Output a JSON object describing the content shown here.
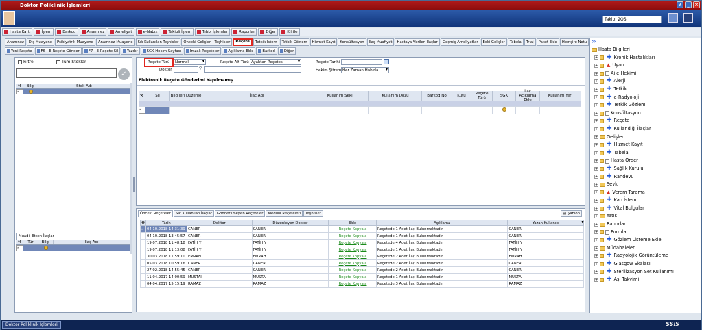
{
  "app": {
    "title": "Doktor Poliklinik İşlemleri",
    "takip": "Takip: 2OS",
    "logo": "SSiS"
  },
  "menu": [
    {
      "label": "Hasta Kartı",
      "icon": "card-icon"
    },
    {
      "label": "İşlem",
      "icon": "process-icon"
    },
    {
      "label": "Barkod",
      "icon": "barcode-icon"
    },
    {
      "label": "Anamnez",
      "icon": "anamnez-icon"
    },
    {
      "label": "Ameliyat",
      "icon": "surgery-icon"
    },
    {
      "label": "e-Nabız",
      "icon": "pulse-icon"
    },
    {
      "label": "Takipli İşlem",
      "icon": "track-icon"
    },
    {
      "label": "Tıbbi İşlemler",
      "icon": "medical-icon"
    },
    {
      "label": "Raporlar",
      "icon": "report-icon"
    },
    {
      "label": "Diğer",
      "icon": "other-icon"
    },
    {
      "label": "Kilitle",
      "icon": "lock-icon"
    }
  ],
  "tabs": [
    "Anamnez",
    "Dış Muayene",
    "Psikiyatrik Muayene",
    "Anamnez Muayene",
    "Sık Kullanılan Teşhisler",
    "Önceki Gelişler - Teşhisler",
    "Reçete",
    "Tetkik İstem",
    "Tetkik Gözlem",
    "Hizmet Kayıt",
    "Konsültasyon",
    "İlaç Muafiyet",
    "Hastaya Verilen İlaçlar",
    "Geçmiş Ameliyatlar",
    "Eski Gelişler",
    "Tabela",
    "Triaj",
    "Paket Ekle",
    "Hemşire Notu"
  ],
  "toolbar": [
    "Yeni Reçete",
    "F6 - E-Reçete Gönder",
    "F7 - E-Reçete Sil",
    "Yazdır",
    "SGK Hekim Sayfası",
    "İmzalı Reçeteler",
    "Açıklama Ekle",
    "Barkod",
    "Diğer"
  ],
  "left": {
    "filtre": "Filtre",
    "tum_stoklar": "Tüm Stoklar",
    "col_bilgi": "Bilgi",
    "col_stok_adi": "Stok Adı",
    "muadil_tab": "Muadil Etken İlaçlar",
    "col_tur": "Tür",
    "col_bilgi2": "Bilgi",
    "col_ilac_adi": "İlaç Adı"
  },
  "form": {
    "recete_turu_label": "Reçete Türü",
    "recete_turu": "Normal",
    "doktor_label": "Doktor",
    "alt_turu_label": "Reçete Alt Türü",
    "alt_turu": "Ayaktan Reçetesi",
    "tarih_label": "Reçete Tarihi",
    "sitem_label": "Hekim Şitremi",
    "sitem": "Her Zaman Habirla",
    "status": "Elektronik Reçete Gönderimi Yapılmamış"
  },
  "rx_cols": [
    "Sil",
    "Bilgileri Düzenle",
    "İlaç Adı",
    "Kullanım Şekli",
    "Kullanım Dozu",
    "Barkod No",
    "Kutu",
    "Reçete Türü",
    "SGK",
    "İlaç Açıklama Ekle",
    "Kullanım Yeri"
  ],
  "bottom_tabs": [
    "Önceki Reçeteler",
    "Sık Kullanılan İlaçlar",
    "Gönderilmeyen Reçeteler",
    "Medula Reçeteleri",
    "Teşhisler"
  ],
  "sablon": "Şablon",
  "history": {
    "cols": [
      "Tarih",
      "Doktor",
      "Düzenleyen Doktor",
      "Ekle",
      "Açıklama",
      "Yazan Kullanıcı"
    ],
    "rows": [
      {
        "tarih": "04.10.2018 14:31:39",
        "doktor": "CANER",
        "duzenleyen": "CANER",
        "ekle": "Reçete Kopyala",
        "aciklama": "Reçetede 1 Adet İlaç Bulunmaktadır.",
        "yazan": "CANER"
      },
      {
        "tarih": "04.10.2018 13:45:57",
        "doktor": "CANER",
        "duzenleyen": "CANER",
        "ekle": "Reçete Kopyala",
        "aciklama": "Reçetede 1 Adet İlaç Bulunmaktadır.",
        "yazan": "CANER"
      },
      {
        "tarih": "19.07.2018 11:48:18",
        "doktor": "FATİH Y",
        "duzenleyen": "FATİH Y",
        "ekle": "Reçete Kopyala",
        "aciklama": "Reçetede 4 Adet İlaç Bulunmaktadır.",
        "yazan": "FATİH Y"
      },
      {
        "tarih": "19.07.2018 11:13:08",
        "doktor": "FATİH Y",
        "duzenleyen": "FATİH Y",
        "ekle": "Reçete Kopyala",
        "aciklama": "Reçetede 1 Adet İlaç Bulunmaktadır.",
        "yazan": "FATİH Y"
      },
      {
        "tarih": "30.03.2018 11:59:10",
        "doktor": "EMRAH",
        "duzenleyen": "EMRAH",
        "ekle": "Reçete Kopyala",
        "aciklama": "Reçetede 2 Adet İlaç Bulunmaktadır.",
        "yazan": "EMRAH"
      },
      {
        "tarih": "05.03.2018 10:59:16",
        "doktor": "CANER",
        "duzenleyen": "CANER",
        "ekle": "Reçete Kopyala",
        "aciklama": "Reçetede 2 Adet İlaç Bulunmaktadır.",
        "yazan": "CANER"
      },
      {
        "tarih": "27.02.2018 14:55:45",
        "doktor": "CANER",
        "duzenleyen": "CANER",
        "ekle": "Reçete Kopyala",
        "aciklama": "Reçetede 2 Adet İlaç Bulunmaktadır.",
        "yazan": "CANER"
      },
      {
        "tarih": "11.04.2017 14:00:59",
        "doktor": "MUSTAI",
        "duzenleyen": "MUSTAI",
        "ekle": "Reçete Kopyala",
        "aciklama": "Reçetede 1 Adet İlaç Bulunmaktadır.",
        "yazan": "MUSTAI"
      },
      {
        "tarih": "04.04.2017 15:15:19",
        "doktor": "RAMAZ",
        "duzenleyen": "RAMAZ",
        "ekle": "Reçete Kopyala",
        "aciklama": "Reçetede 3 Adet İlaç Bulunmaktadır.",
        "yazan": "RAMAZ"
      }
    ]
  },
  "tree_title": "Hasta Bilgileri",
  "tree": [
    {
      "label": "Kronik Hastalıkları",
      "lvl": 1,
      "type": "plus"
    },
    {
      "label": "Uyarı",
      "lvl": 1,
      "type": "warn"
    },
    {
      "label": "Aile Hekimi",
      "lvl": 1,
      "type": "doc"
    },
    {
      "label": "Alerji",
      "lvl": 1,
      "type": "plus"
    },
    {
      "label": "Tetkik",
      "lvl": 1,
      "type": "plus"
    },
    {
      "label": "e-Radyoloji",
      "lvl": 1,
      "type": "plus"
    },
    {
      "label": "Tetkik Gözlem",
      "lvl": 1,
      "type": "plus"
    },
    {
      "label": "Konsültasyon",
      "lvl": 1,
      "type": "doc"
    },
    {
      "label": "Reçete",
      "lvl": 1,
      "type": "plus"
    },
    {
      "label": "Kullandığı İlaçlar",
      "lvl": 1,
      "type": "plus"
    },
    {
      "label": "Gelişler",
      "lvl": 0,
      "type": "folder"
    },
    {
      "label": "Hizmet Kayıt",
      "lvl": 1,
      "type": "plus"
    },
    {
      "label": "Tabela",
      "lvl": 1,
      "type": "plus"
    },
    {
      "label": "Hasta Order",
      "lvl": 1,
      "type": "doc"
    },
    {
      "label": "Sağlık Kurulu",
      "lvl": 1,
      "type": "plus"
    },
    {
      "label": "Randevu",
      "lvl": 1,
      "type": "plus"
    },
    {
      "label": "Sevk",
      "lvl": 0,
      "type": "folder"
    },
    {
      "label": "Verem Tarama",
      "lvl": 1,
      "type": "warn"
    },
    {
      "label": "Kan İstemi",
      "lvl": 1,
      "type": "plus"
    },
    {
      "label": "Vital Bulgular",
      "lvl": 1,
      "type": "plus"
    },
    {
      "label": "Yatış",
      "lvl": 0,
      "type": "folder"
    },
    {
      "label": "Raporlar",
      "lvl": 0,
      "type": "folder"
    },
    {
      "label": "Formlar",
      "lvl": 1,
      "type": "doc"
    },
    {
      "label": "Gözlem Listeme Ekle",
      "lvl": 1,
      "type": "plus"
    },
    {
      "label": "Müdahaleler",
      "lvl": 0,
      "type": "folder"
    },
    {
      "label": "Radyolojik Görüntüleme",
      "lvl": 1,
      "type": "plus"
    },
    {
      "label": "Glasgow Skalası",
      "lvl": 1,
      "type": "plus"
    },
    {
      "label": "Sterilizasyon Set Kullanımı",
      "lvl": 1,
      "type": "plus"
    },
    {
      "label": "Aşı Takvimi",
      "lvl": 1,
      "type": "plus"
    }
  ],
  "taskbar": "Doktor Poliklinik İşlemleri"
}
